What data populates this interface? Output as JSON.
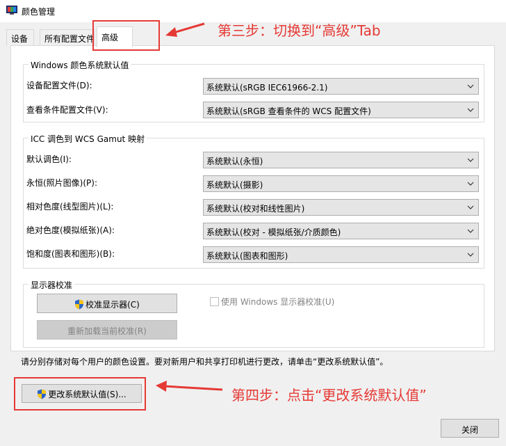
{
  "window": {
    "title": "颜色管理"
  },
  "tabs": [
    {
      "label": "设备"
    },
    {
      "label": "所有配置文件"
    },
    {
      "label": "高级"
    }
  ],
  "defaults_group": {
    "title": "Windows 颜色系统默认值",
    "rows": [
      {
        "label": "设备配置文件(D):",
        "value": "系统默认(sRGB IEC61966-2.1)"
      },
      {
        "label": "查看条件配置文件(V):",
        "value": "系统默认(sRGB 查看条件的 WCS 配置文件)"
      }
    ]
  },
  "icc_group": {
    "title": "ICC 调色到 WCS Gamut 映射",
    "rows": [
      {
        "label": "默认调色(I):",
        "value": "系统默认(永恒)"
      },
      {
        "label": "永恒(照片图像)(P):",
        "value": "系统默认(摄影)"
      },
      {
        "label": "相对色度(线型图片)(L):",
        "value": "系统默认(校对和线性图片)"
      },
      {
        "label": "绝对色度(模拟纸张)(A):",
        "value": "系统默认(校对 - 模拟纸张/介质颜色)"
      },
      {
        "label": "饱和度(图表和图形)(B):",
        "value": "系统默认(图表和图形)"
      }
    ]
  },
  "calibration_group": {
    "title": "显示器校准",
    "calibrate_button": "校准显示器(C)",
    "reload_button": "重新加载当前校准(R)",
    "use_windows_checkbox": {
      "label": "使用 Windows 显示器校准(U)",
      "checked": false
    }
  },
  "note": "请分别存储对每个用户的颜色设置。要对新用户和共享打印机进行更改，请单击“更改系统默认值”。",
  "change_defaults_button": "更改系统默认值(S)...",
  "close_button": "关闭",
  "annotations": {
    "step3": "第三步：切换到“高级”Tab",
    "step4": "第四步：点击“更改系统默认值”"
  },
  "colors": {
    "annotation_red": "#e53935",
    "shield_blue": "#2b64c9",
    "shield_yellow": "#f5c518"
  }
}
